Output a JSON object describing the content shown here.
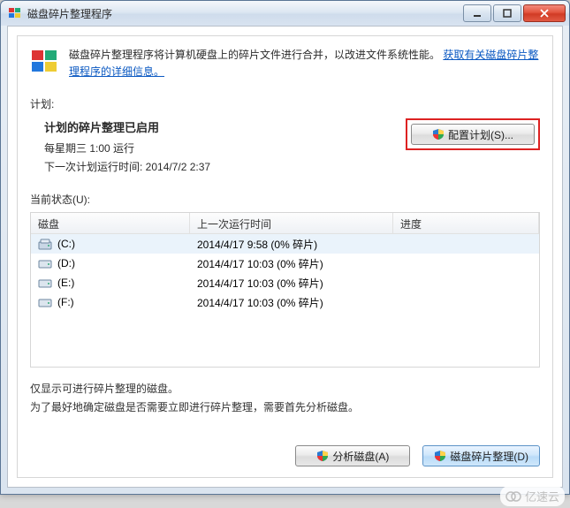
{
  "window": {
    "title": "磁盘碎片整理程序"
  },
  "intro": {
    "text_before_link": "磁盘碎片整理程序将计算机硬盘上的碎片文件进行合并，以改进文件系统性能。",
    "link_text": "获取有关磁盘碎片整理程序的详细信息。"
  },
  "labels": {
    "schedule": "计划:",
    "current_status": "当前状态(U):"
  },
  "schedule": {
    "title": "计划的碎片整理已启用",
    "line1": "每星期三  1:00 运行",
    "line2": "下一次计划运行时间: 2014/7/2 2:37",
    "config_button": "配置计划(S)..."
  },
  "table": {
    "headers": {
      "disk": "磁盘",
      "last_run": "上一次运行时间",
      "progress": "进度"
    },
    "rows": [
      {
        "icon": "c",
        "name": "(C:)",
        "last_run": "2014/4/17 9:58 (0% 碎片)",
        "progress": ""
      },
      {
        "icon": "hdd",
        "name": "(D:)",
        "last_run": "2014/4/17 10:03 (0% 碎片)",
        "progress": ""
      },
      {
        "icon": "hdd",
        "name": "(E:)",
        "last_run": "2014/4/17 10:03 (0% 碎片)",
        "progress": ""
      },
      {
        "icon": "hdd",
        "name": "(F:)",
        "last_run": "2014/4/17 10:03 (0% 碎片)",
        "progress": ""
      }
    ]
  },
  "notes": {
    "line1": "仅显示可进行碎片整理的磁盘。",
    "line2": "为了最好地确定磁盘是否需要立即进行碎片整理，需要首先分析磁盘。"
  },
  "footer": {
    "analyze": "分析磁盘(A)",
    "defrag": "磁盘碎片整理(D)"
  },
  "watermark": {
    "text": "亿速云"
  }
}
